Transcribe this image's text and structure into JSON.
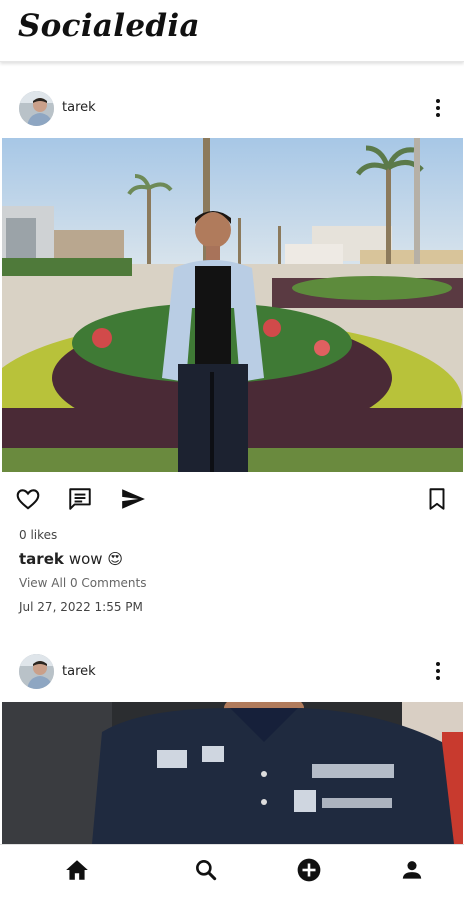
{
  "app": {
    "title": "Socialedia"
  },
  "posts": [
    {
      "username": "tarek",
      "likes_text": "0 likes",
      "caption_user": "tarek",
      "caption_text": "wow",
      "caption_emoji": "😍",
      "comments_text": "View All 0 Comments",
      "timestamp": "Jul 27, 2022 1:55 PM"
    },
    {
      "username": "tarek"
    }
  ],
  "post_actions": [
    "like-icon",
    "comment-icon",
    "share-icon",
    "bookmark-icon"
  ],
  "bottom_nav": [
    "home-icon",
    "search-icon",
    "add-post-icon",
    "profile-icon"
  ],
  "colors": {
    "accent": "#111111",
    "background": "#ffffff"
  }
}
